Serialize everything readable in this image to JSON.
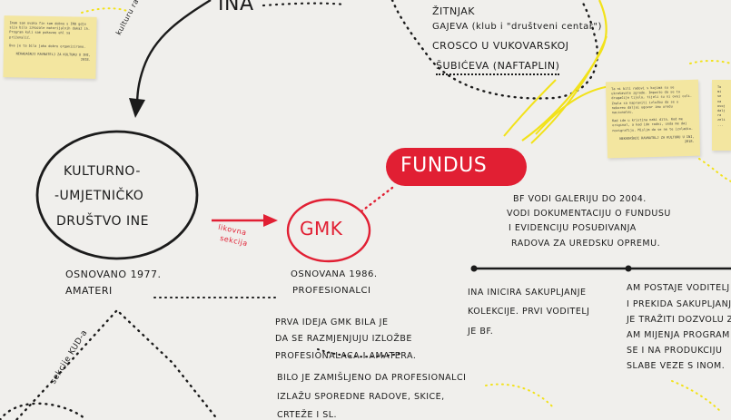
{
  "top_word": "INA",
  "curve_label": "kulturu radnicima",
  "kud": {
    "line1": "KULTURNO-",
    "line2": "-UMJETNIČKO",
    "line3": "DRUŠTVO INE",
    "founded": "OSNOVANO 1977.",
    "status": "AMATERI"
  },
  "arrow_label": {
    "line1": "likovna",
    "line2": "sekcija"
  },
  "gmk": {
    "name": "GMK",
    "founded": "OSNOVANA 1986.",
    "status": "PROFESIONALCI"
  },
  "fundus": {
    "name": "FUNDUS",
    "text": [
      "BF VODI GALERIJU DO 2004.",
      "VODI DOKUMENTACIJU O FUNDUSU",
      "I EVIDENCIJU POSUĐIVANJA",
      "RADOVA ZA UREDSKU OPREMU."
    ]
  },
  "locations": [
    "ŽITNJAK",
    "GAJEVA (klub i \"društveni centar\")",
    "CROSCO U VUKOVARSKOJ",
    "ŠUBIĆEVA (NAFTAPLIN)"
  ],
  "sekcije_label": "sekcije KUD-a",
  "gmk_text": [
    "PRVA IDEJA GMK BILA JE",
    "DA SE RAZMJENJUJU IZLOŽBE",
    "PROFESIONALACA I AMATERA.",
    "BILO JE ZAMIŠLJENO DA PROFESIONALCI",
    "IZLAŽU SPOREDNE RADOVE, SKICE,",
    "CRTEŽE I SL."
  ],
  "ina_text": [
    "INA INICIRA SAKUPLJANJE",
    "KOLEKCIJE. PRVI VODITELJ",
    "JE BF."
  ],
  "right_text": [
    "AM POSTAJE VODITELJ",
    "I PREKIDA SAKUPLJANJE K",
    "JE TRAŽITI DOZVOLU ZA",
    "AM MIJENJA PROGRAM",
    "SE I NA PRODUKCIJU",
    "SLABE VEZE S INOM."
  ],
  "notes": {
    "left": {
      "paragraphs": [
        "Imam sam ovaka fin sam dobno s INO gdje sija bila izkazale materijalnih dokaž ih. Program kuli sam pokazao ehl sa priženalić.",
        "Ova je ta bila jako dobro organizirano."
      ],
      "signature": "NEKADAŠNJI RAVNATELJ ZA KULTURU U INI, 2018."
    },
    "right": {
      "paragraphs": [
        "Ta ni bili radovi s kojima su se ukrašavale zgrade. Imposto da se to drugačije tijelo, tijeli su ni ovoj celi. Znala sa napraviti izložbu da se u nekoreo daljai ugovor imo uredu nacionalnu.",
        "Kad ide u kristina naki dila. Kod me original, a kad ide radni, onda me daj novigrafiju. Mislim da se ne te izvladio."
      ],
      "signature": "NEKADAŠNJI RAVNATELJ ZA KULTURU U INI, 2018."
    },
    "edge": {
      "paragraphs": [
        "To mi se na ovoj dalj ra zeli ..."
      ]
    }
  },
  "colors": {
    "red": "#e11f33",
    "yellow": "#f2e21a",
    "ink": "#1b1b1b",
    "note": "#f3e6a0"
  }
}
